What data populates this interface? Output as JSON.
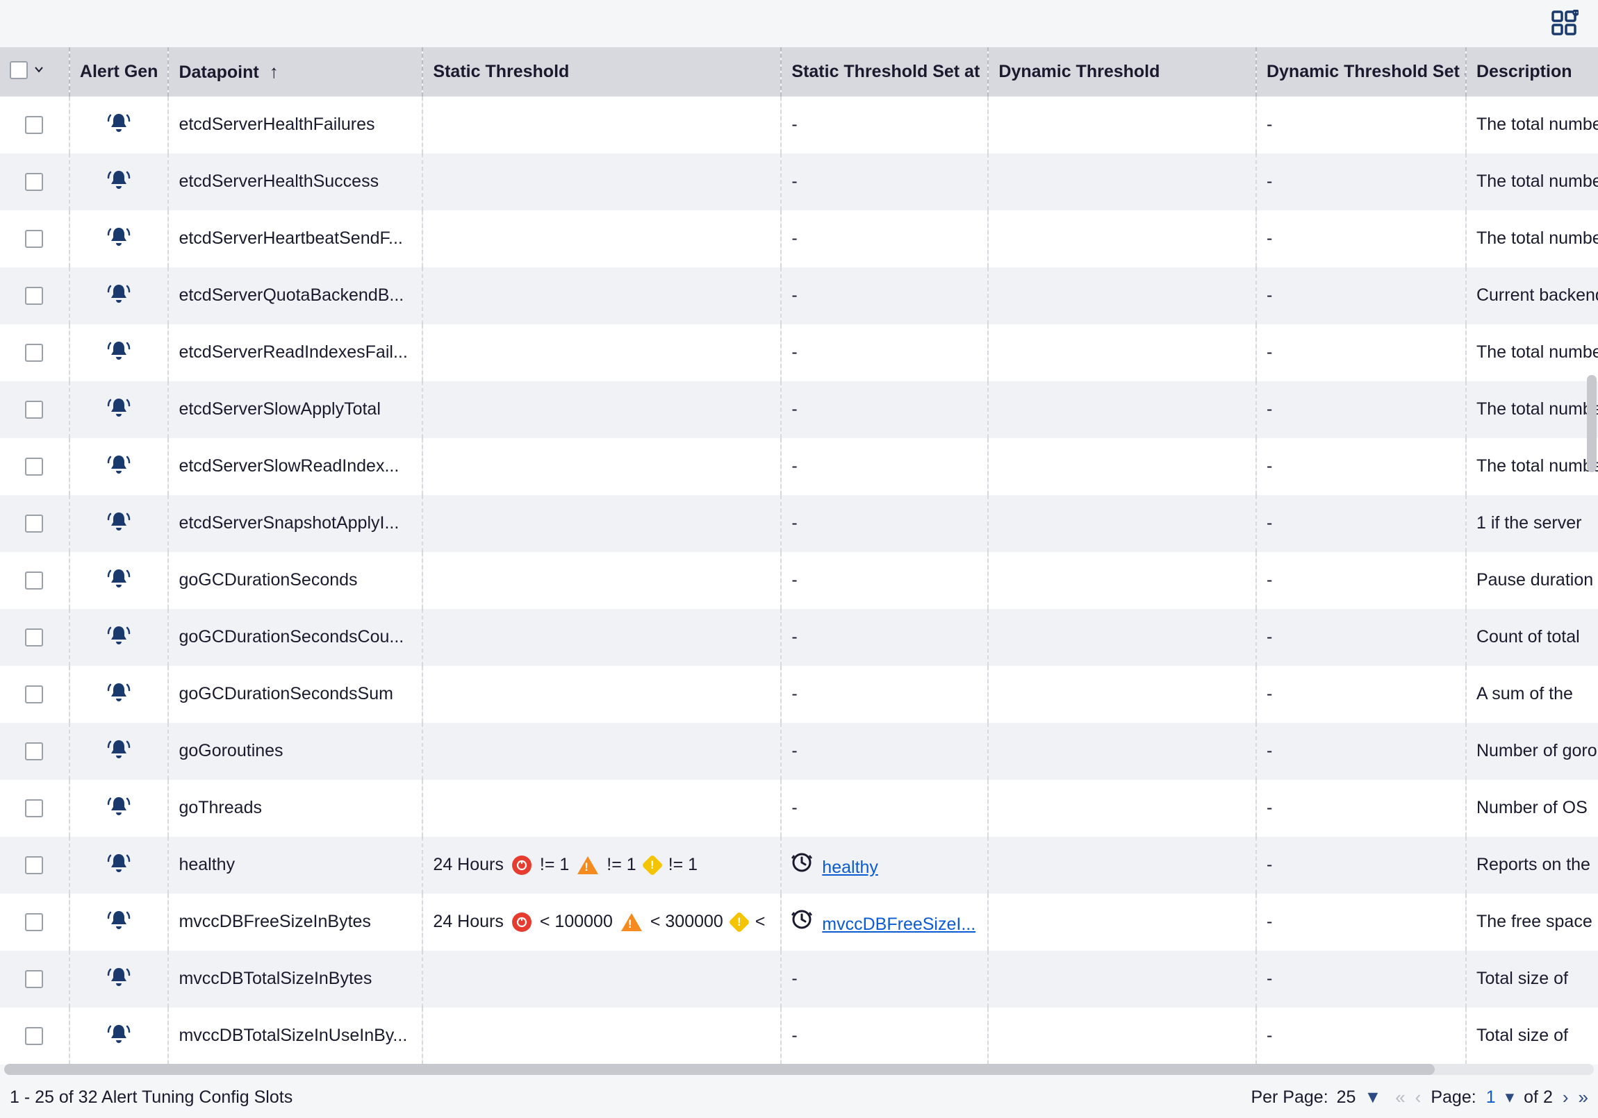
{
  "header_icon": "apps-grid",
  "columns": {
    "alert_gen": "Alert Gen",
    "datapoint": "Datapoint",
    "static_threshold": "Static Threshold",
    "static_threshold_at": "Static Threshold Set at",
    "dynamic_threshold": "Dynamic Threshold",
    "dynamic_threshold_at": "Dynamic Threshold Set at",
    "description": "Description"
  },
  "sort_indicator": "↑",
  "rows": [
    {
      "datapoint": "etcdServerHealthFailures",
      "static": "",
      "static_at": "-",
      "dyn": "",
      "dyn_at": "-",
      "desc": "The total number"
    },
    {
      "datapoint": "etcdServerHealthSuccess",
      "static": "",
      "static_at": "-",
      "dyn": "",
      "dyn_at": "-",
      "desc": "The total number"
    },
    {
      "datapoint": "etcdServerHeartbeatSendF...",
      "static": "",
      "static_at": "-",
      "dyn": "",
      "dyn_at": "-",
      "desc": "The total number"
    },
    {
      "datapoint": "etcdServerQuotaBackendB...",
      "static": "",
      "static_at": "-",
      "dyn": "",
      "dyn_at": "-",
      "desc": "Current backend"
    },
    {
      "datapoint": "etcdServerReadIndexesFail...",
      "static": "",
      "static_at": "-",
      "dyn": "",
      "dyn_at": "-",
      "desc": "The total number"
    },
    {
      "datapoint": "etcdServerSlowApplyTotal",
      "static": "",
      "static_at": "-",
      "dyn": "",
      "dyn_at": "-",
      "desc": "The total number"
    },
    {
      "datapoint": "etcdServerSlowReadIndex...",
      "static": "",
      "static_at": "-",
      "dyn": "",
      "dyn_at": "-",
      "desc": "The total number"
    },
    {
      "datapoint": "etcdServerSnapshotApplyI...",
      "static": "",
      "static_at": "-",
      "dyn": "",
      "dyn_at": "-",
      "desc": "1 if the server"
    },
    {
      "datapoint": "goGCDurationSeconds",
      "static": "",
      "static_at": "-",
      "dyn": "",
      "dyn_at": "-",
      "desc": "Pause duration"
    },
    {
      "datapoint": "goGCDurationSecondsCou...",
      "static": "",
      "static_at": "-",
      "dyn": "",
      "dyn_at": "-",
      "desc": "Count of total"
    },
    {
      "datapoint": "goGCDurationSecondsSum",
      "static": "",
      "static_at": "-",
      "dyn": "",
      "dyn_at": "-",
      "desc": "A sum of the"
    },
    {
      "datapoint": "goGoroutines",
      "static": "",
      "static_at": "-",
      "dyn": "",
      "dyn_at": "-",
      "desc": "Number of goroutines"
    },
    {
      "datapoint": "goThreads",
      "static": "",
      "static_at": "-",
      "dyn": "",
      "dyn_at": "-",
      "desc": "Number of OS"
    },
    {
      "datapoint": "healthy",
      "static_kind": "eq1",
      "static_prefix": "24 Hours",
      "static_at_link": "healthy",
      "dyn": "",
      "dyn_at": "-",
      "desc": "Reports on the"
    },
    {
      "datapoint": "mvccDBFreeSizeInBytes",
      "static_kind": "freesize",
      "static_prefix": "24 Hours",
      "static_at_link": "mvccDBFreeSizeI...",
      "dyn": "",
      "dyn_at": "-",
      "desc": "The free space"
    },
    {
      "datapoint": "mvccDBTotalSizeInBytes",
      "static": "",
      "static_at": "-",
      "dyn": "",
      "dyn_at": "-",
      "desc": "Total size of"
    },
    {
      "datapoint": "mvccDBTotalSizeInUseInBy...",
      "static": "",
      "static_at": "-",
      "dyn": "",
      "dyn_at": "-",
      "desc": "Total size of"
    }
  ],
  "thresholds": {
    "eq1": {
      "crit": "!= 1",
      "warn": "!= 1",
      "minor": "!= 1"
    },
    "freesize": {
      "crit": "< 100000",
      "warn": "< 300000",
      "minor": "<"
    }
  },
  "footer": {
    "summary": "1 - 25 of 32 Alert Tuning Config Slots",
    "per_page_label": "Per Page:",
    "per_page_value": "25",
    "page_label": "Page:",
    "page_current": "1",
    "page_of": "of 2"
  }
}
